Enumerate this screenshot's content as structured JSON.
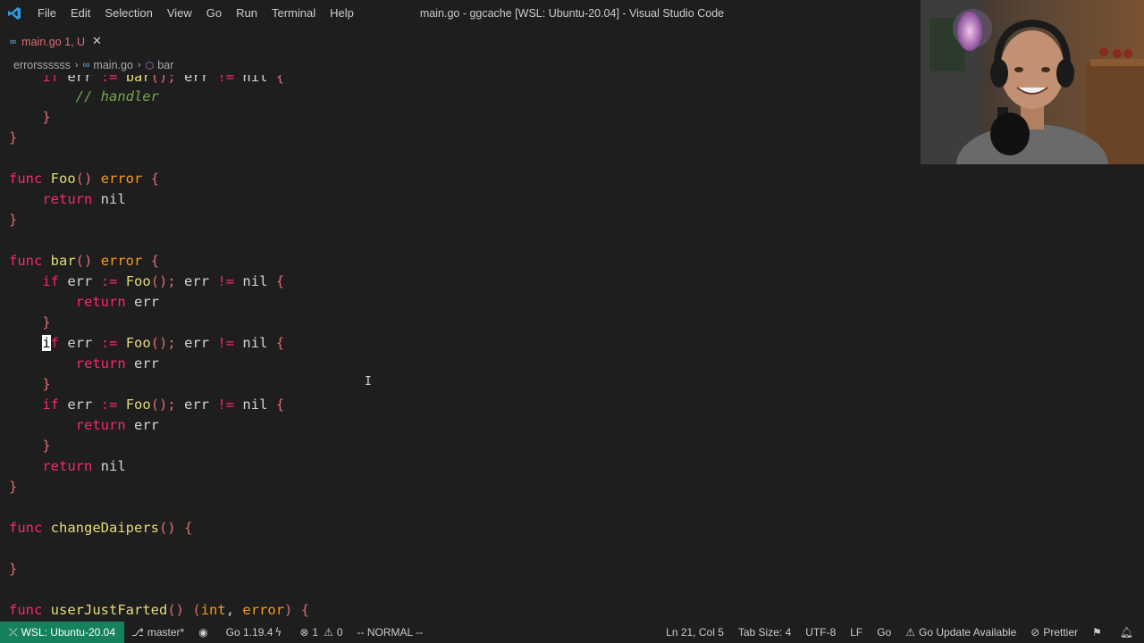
{
  "titlebar": {
    "menu": [
      "File",
      "Edit",
      "Selection",
      "View",
      "Go",
      "Run",
      "Terminal",
      "Help"
    ],
    "window_title": "main.go - ggcache [WSL: Ubuntu-20.04] - Visual Studio Code"
  },
  "tab": {
    "label": "main.go 1, U",
    "icon": "go-file-icon"
  },
  "breadcrumbs": {
    "folder": "errorssssss",
    "file": "main.go",
    "symbol": "bar"
  },
  "editor": {
    "code": {
      "l0": [
        "if",
        "err",
        ":=",
        "bar",
        "();",
        "err",
        "!=",
        "nil",
        "{"
      ],
      "l1": "// handler",
      "func": "func",
      "foo_name": "Foo",
      "bar_name": "bar",
      "error_type": "error",
      "return": "return",
      "nil": "nil",
      "if": "if",
      "err": "err",
      "assign": ":=",
      "call_sep": "();",
      "neq": "!=",
      "change_name": "changeDaipers",
      "farted_name": "userJustFarted",
      "int_type": "int",
      "i_char": "i",
      "f_char": "f"
    }
  },
  "statusbar": {
    "remote": "WSL: Ubuntu-20.04",
    "branch": "master*",
    "go_version": "Go 1.19.4",
    "errors": "1",
    "warnings": "0",
    "mode": "-- NORMAL --",
    "position": "Ln 21, Col 5",
    "tab_size": "Tab Size: 4",
    "encoding": "UTF-8",
    "eol": "LF",
    "language": "Go",
    "go_update": "Go Update Available",
    "prettier": "Prettier"
  },
  "colors": {
    "keyword": "#f92672",
    "function": "#e6db74",
    "type": "#fd971f",
    "comment": "#75a94a",
    "remote_bg": "#16825d"
  }
}
